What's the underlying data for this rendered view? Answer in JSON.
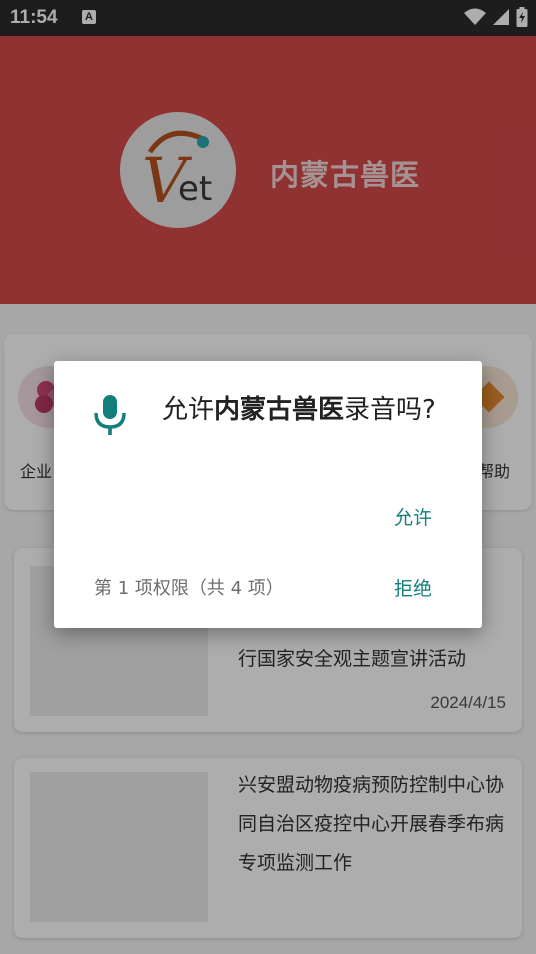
{
  "status_bar": {
    "time": "11:54",
    "notification_icon": "A"
  },
  "header": {
    "app_name": "内蒙古兽医",
    "logo_text_v": "V",
    "logo_text_et": "et"
  },
  "shortcuts": [
    {
      "label": "企业",
      "icon": "flower-icon"
    },
    {
      "label": "帮助",
      "icon": "help-icon"
    }
  ],
  "news": [
    {
      "title": "行国家安全观主题宣讲活动",
      "date": "2024/4/15"
    },
    {
      "title": "兴安盟动物疫病预防控制中心协同自治区疫控中心开展春季布病专项监测工作",
      "date": ""
    }
  ],
  "dialog": {
    "title_prefix": "允许",
    "title_app": "内蒙古兽医",
    "title_suffix": "录音吗?",
    "allow_label": "允许",
    "counter": "第 1 项权限（共 4 项）",
    "deny_label": "拒绝"
  },
  "colors": {
    "header": "#d44a4b",
    "accent": "#127f7a",
    "scrim": "rgba(0,0,0,0.32)"
  }
}
